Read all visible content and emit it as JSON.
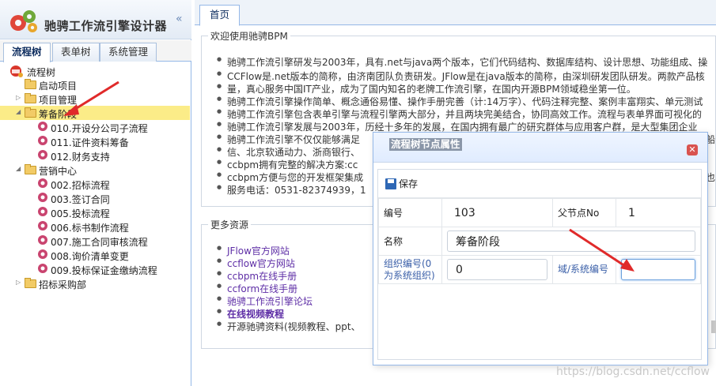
{
  "app": {
    "title": "驰骋工作流引擎设计器",
    "collapse_glyph": "«"
  },
  "left_tabs": [
    {
      "label": "流程树",
      "active": true
    },
    {
      "label": "表单树",
      "active": false
    },
    {
      "label": "系统管理",
      "active": false
    }
  ],
  "tree": {
    "root": "流程树",
    "nodes": [
      {
        "label": "启动项目",
        "level": 1,
        "kind": "folder",
        "expanded": false,
        "has_children": false
      },
      {
        "label": "项目管理",
        "level": 1,
        "kind": "folder",
        "expanded": false,
        "has_children": true
      },
      {
        "label": "筹备阶段",
        "level": 1,
        "kind": "folder",
        "expanded": true,
        "has_children": true,
        "selected": true
      },
      {
        "label": "010.开设分公司子流程",
        "level": 2,
        "kind": "flow"
      },
      {
        "label": "011.证件资料筹备",
        "level": 2,
        "kind": "flow"
      },
      {
        "label": "012.财务支持",
        "level": 2,
        "kind": "flow"
      },
      {
        "label": "营销中心",
        "level": 1,
        "kind": "folder",
        "expanded": true,
        "has_children": true
      },
      {
        "label": "002.招标流程",
        "level": 2,
        "kind": "flow"
      },
      {
        "label": "003.签订合同",
        "level": 2,
        "kind": "flow"
      },
      {
        "label": "005.投标流程",
        "level": 2,
        "kind": "flow"
      },
      {
        "label": "006.标书制作流程",
        "level": 2,
        "kind": "flow"
      },
      {
        "label": "007.施工合同审核流程",
        "level": 2,
        "kind": "flow"
      },
      {
        "label": "008.询价清单变更",
        "level": 2,
        "kind": "flow"
      },
      {
        "label": "009.投标保证金缴纳流程",
        "level": 2,
        "kind": "flow"
      },
      {
        "label": "招标采购部",
        "level": 1,
        "kind": "folder",
        "expanded": false,
        "has_children": true
      }
    ]
  },
  "main": {
    "tab_label": "首页",
    "welcome": {
      "legend": "欢迎使用驰骋BPM",
      "bullets": [
        "驰骋工作流引擎研发与2003年，具有.net与java两个版本，它们代码结构、数据库结构、设计思想、功能组成、操",
        "CCFlow是.net版本的简称，由济南团队负责研发。JFlow是在java版本的简称，由深圳研发团队研发。两款产品核",
        "驰骋工作流引擎操作简单、概念通俗易懂、操作手册完善（计:14万字）、代码注释完整、案例丰富翔实、单元测试",
        "驰骋工作流引擎包含表单引擎与流程引擎两大部分，并且两块完美结合，协同高效工作。流程与表单界面可视化的",
        "驰骋工作流引擎发展与2003年，历经十多年的发展，在国内拥有最广的研究群体与应用客户群，是大型集团企业",
        "驰骋工作流引擎不仅仅能够满足",
        "ccbpm拥有完整的解决方案:cc",
        "ccbpm方便与您的开发框架集成",
        "服务电话：0531-82374939，1"
      ],
      "bullet1_cont": "量，真心服务中国IT产业，成为了国内知名的老牌工作流引擎，在国内开源BPM领域稳坐第一位。",
      "bullet6_cont": "信、北京软通动力、浙商银行、",
      "bullet6_tail": "船",
      "bullet8_tail": "也"
    },
    "resources": {
      "legend": "更多资源",
      "items": [
        {
          "label": "JFlow官方网站",
          "link": true
        },
        {
          "label": "ccflow官方网站",
          "link": true
        },
        {
          "label": "ccbpm在线手册",
          "link": true
        },
        {
          "label": "ccform在线手册",
          "link": true
        },
        {
          "label": "驰骋工作流引擎论坛",
          "link": true
        },
        {
          "label": "在线视频教程",
          "link": true,
          "bold": true
        },
        {
          "label": "开源驰骋资料(视频教程、ppt、",
          "link": false
        }
      ]
    }
  },
  "dialog": {
    "title": "流程树节点属性",
    "close_glyph": "✕",
    "save_label": "保存",
    "fields": {
      "no_label": "编号",
      "no_value": "103",
      "parent_label": "父节点No",
      "parent_value": "1",
      "name_label": "名称",
      "name_value": "筹备阶段",
      "org_label": "组织编号(0为系统组织)",
      "org_value": "0",
      "domain_label": "域/系统编号",
      "domain_value": ""
    }
  },
  "watermark": "https://blog.csdn.net/ccflow",
  "colors": {
    "selection": "#fbec88",
    "panel_border": "#95b8e7",
    "link": "#5e2ea6",
    "arrow": "#e02a2a"
  }
}
